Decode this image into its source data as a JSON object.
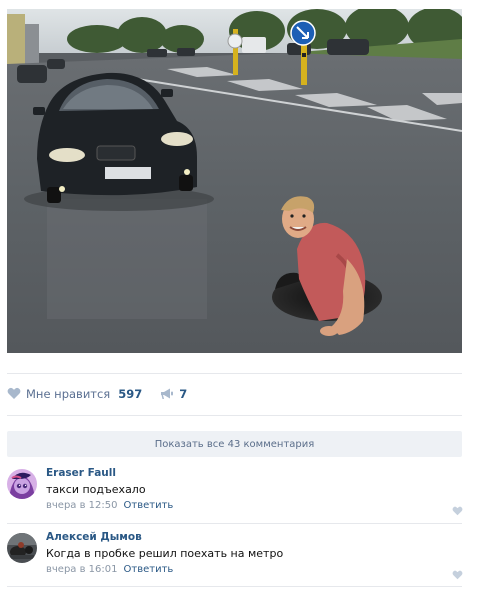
{
  "post": {
    "photo_icon": "street-photo-man-in-manhole"
  },
  "likes": {
    "label": "Мне нравится",
    "count": "597",
    "shares": "7",
    "like_icon": "heart-icon",
    "share_icon": "megaphone-icon"
  },
  "comments_toggle": {
    "label": "Показать все 43 комментария"
  },
  "comments": [
    {
      "author": "Eraser Faull",
      "text": "такси подъехало",
      "time": "вчера в 12:50",
      "reply": "Ответить"
    },
    {
      "author": "Алексей Дымов",
      "text": "Когда в пробке решил поехать на метро",
      "time": "вчера в 16:01",
      "reply": "Ответить"
    }
  ],
  "colors": {
    "link": "#2a5885",
    "muted": "#8a96a5",
    "panel": "#eef1f5"
  }
}
